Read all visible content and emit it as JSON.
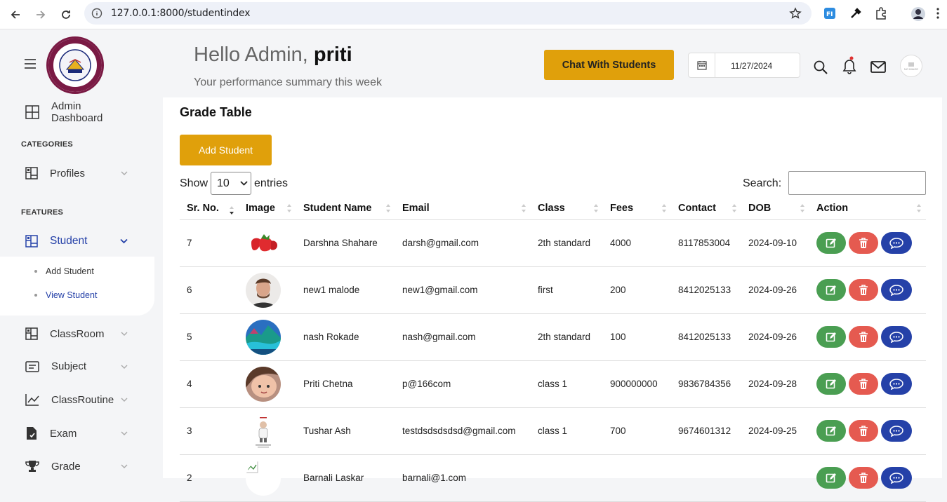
{
  "browser": {
    "url": "127.0.0.1:8000/studentindex"
  },
  "sidebar": {
    "logo_text": "MAHESHWAR VIDYAPEETH",
    "dashboard": "Admin Dashboard",
    "categories_head": "CATEGORIES",
    "profiles": "Profiles",
    "features_head": "FEATURES",
    "student": "Student",
    "sub_add": "Add Student",
    "sub_view": "View Student",
    "classroom": "ClassRoom",
    "subject": "Subject",
    "classroutine": "ClassRoutine",
    "exam": "Exam",
    "grade": "Grade"
  },
  "header": {
    "hello": "Hello Admin,",
    "name": "priti",
    "subtitle": "Your performance summary this week",
    "chat_button": "Chat With Students",
    "date": "11/27/2024",
    "avatar_text": "NO IMAGE"
  },
  "main": {
    "title": "Grade Table",
    "add_button": "Add Student",
    "show": "Show",
    "entries_value": "10",
    "entries": "entries",
    "search_label": "Search:",
    "columns": [
      "Sr. No.",
      "Image",
      "Student Name",
      "Email",
      "Class",
      "Fees",
      "Contact",
      "DOB",
      "Action"
    ],
    "rows": [
      {
        "sr": "7",
        "image": "strawberry",
        "name": "Darshna Shahare",
        "email": "darsh@gmail.com",
        "class": "2th standard",
        "fees": "4000",
        "contact": "8117853004",
        "dob": "2024-09-10"
      },
      {
        "sr": "6",
        "image": "man-portrait",
        "name": "new1 malode",
        "email": "new1@gmail.com",
        "class": "first",
        "fees": "200",
        "contact": "8412025133",
        "dob": "2024-09-26"
      },
      {
        "sr": "5",
        "image": "landscape",
        "name": "nash Rokade",
        "email": "nash@gmail.com",
        "class": "2th standard",
        "fees": "100",
        "contact": "8412025133",
        "dob": "2024-09-26"
      },
      {
        "sr": "4",
        "image": "child-portrait",
        "name": "Priti Chetna",
        "email": "p@166com",
        "class": "class 1",
        "fees": "900000000",
        "contact": "9836784356",
        "dob": "2024-09-28"
      },
      {
        "sr": "3",
        "image": "figure-poster",
        "name": "Tushar Ash",
        "email": "testdsdsdsdsd@gmail.com",
        "class": "class 1",
        "fees": "700",
        "contact": "9674601312",
        "dob": "2024-09-25"
      },
      {
        "sr": "2",
        "image": "broken-image",
        "name": "Barnali Laskar",
        "email": "barnali@1.com",
        "class": "",
        "fees": "",
        "contact": "",
        "dob": ""
      }
    ]
  },
  "colors": {
    "accent": "#e0a00b",
    "primary": "#2541a8",
    "edit": "#4a9e52",
    "delete": "#e55a50"
  }
}
